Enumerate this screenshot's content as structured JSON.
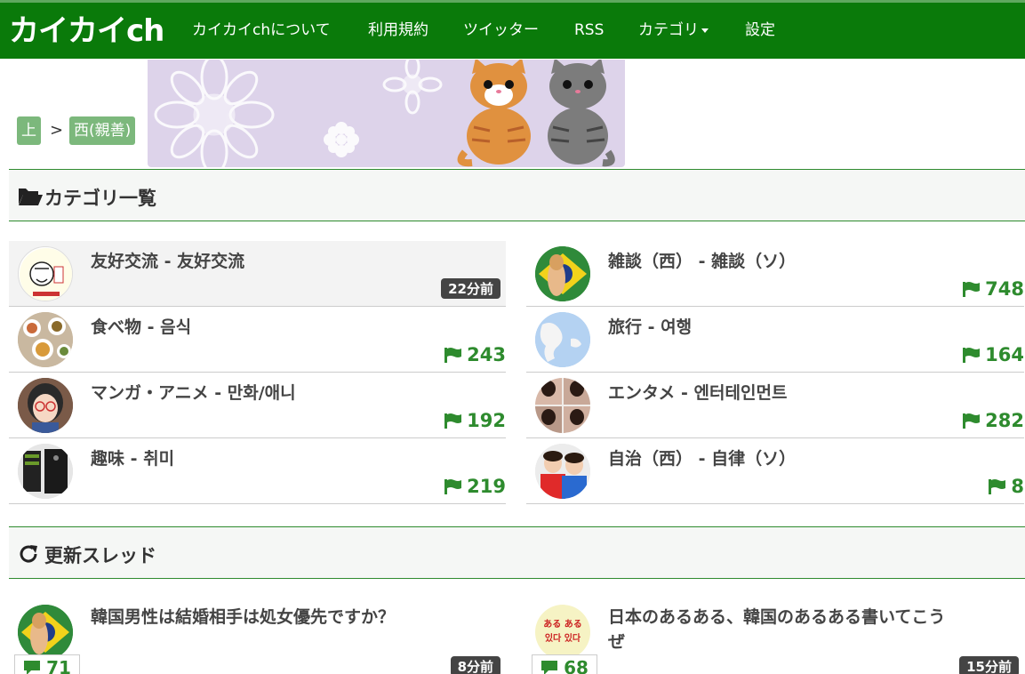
{
  "nav": {
    "brand": "カイカイch",
    "links": [
      "カイカイchについて",
      "利用規約",
      "ツイッター",
      "RSS",
      "カテゴリ",
      "設定"
    ]
  },
  "breadcrumb": {
    "items": [
      "上",
      "西(親善)"
    ],
    "separator": ">"
  },
  "categories_section": {
    "title": "カテゴリ一覧",
    "items": [
      {
        "title": "友好交流 - 友好交流",
        "badge": "22分前"
      },
      {
        "title": "雑談（西） - 雑談（ソ）",
        "count": "748"
      },
      {
        "title": "食べ物 - 음식",
        "count": "243"
      },
      {
        "title": "旅行 - 여행",
        "count": "164"
      },
      {
        "title": "マンガ・アニメ - 만화/애니",
        "count": "192"
      },
      {
        "title": "エンタメ - 엔터테인먼트",
        "count": "282"
      },
      {
        "title": "趣味 - 취미",
        "count": "219"
      },
      {
        "title": "自治（西） - 自律（ソ）",
        "count": "8"
      }
    ]
  },
  "threads_section": {
    "title": "更新スレッド",
    "items": [
      {
        "title": "韓国男性は結婚相手は処女優先ですか？",
        "replies": "71",
        "time": "8分前"
      },
      {
        "title_line1": "日本のあるある、韓国のあるある書いてこう",
        "title_line2": "ぜ",
        "replies": "68",
        "time": "15分前",
        "avatar_text1": "ある ある",
        "avatar_text2": "있다 있다"
      }
    ]
  },
  "colors": {
    "nav_bg": "#0a7a0a",
    "accent": "#2e8b2e",
    "crumb": "#7cb87c",
    "badge": "#444444"
  },
  "icons": {
    "section_categories": "folder-open-icon",
    "section_threads": "refresh-icon",
    "count": "flag-icon",
    "replies": "comment-icon"
  }
}
